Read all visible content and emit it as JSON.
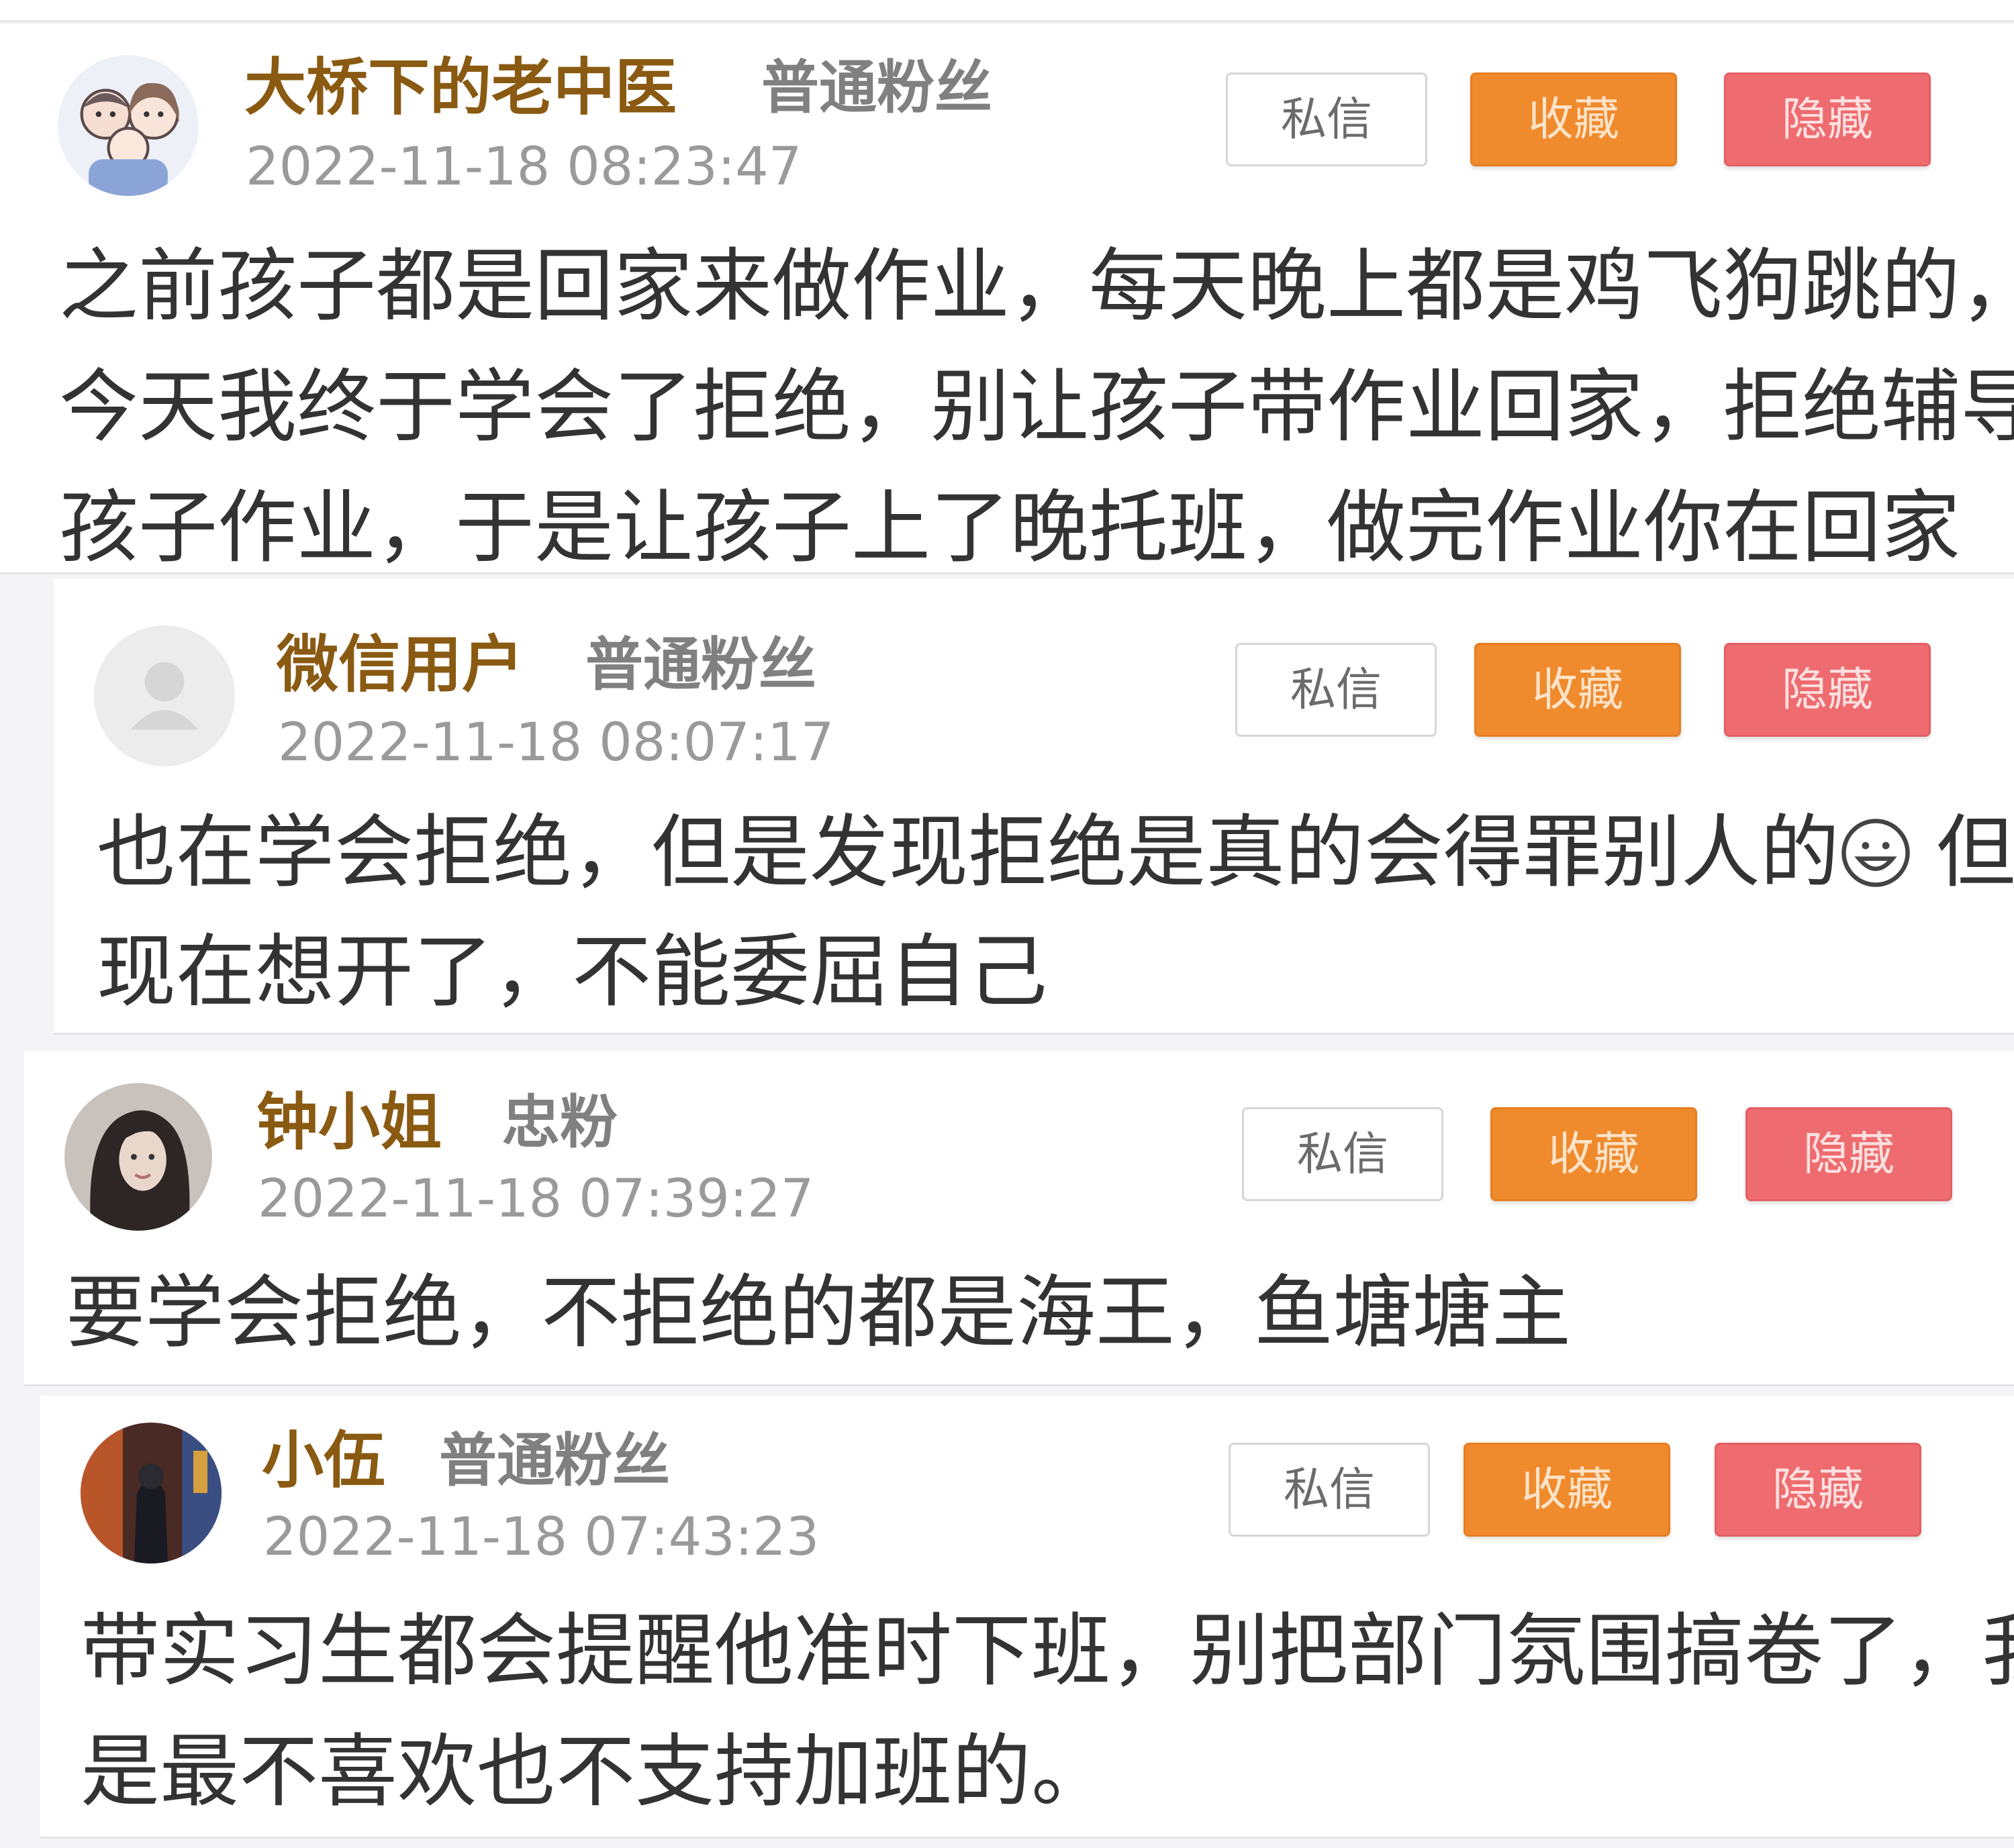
{
  "comments": [
    {
      "username": "大桥下的老中医",
      "badge": "普通粉丝",
      "time": "2022-11-18 08:23:47",
      "buttons": {
        "message": "私信",
        "favorite": "收藏",
        "hide": "隐藏"
      },
      "lines": [
        "之前孩子都是回家来做作业，每天晚上都是鸡飞狗跳的，",
        "今天我终于学会了拒绝，别让孩子带作业回家，拒绝辅导",
        "孩子作业，于是让孩子上了晚托班，做完作业你在回家"
      ]
    },
    {
      "username": "微信用户",
      "badge": "普通粉丝",
      "time": "2022-11-18 08:07:17",
      "buttons": {
        "message": "私信",
        "favorite": "收藏",
        "hide": "隐藏"
      },
      "lines": [
        "也在学会拒绝，但是发现拒绝是真的会得罪别人的",
        "但是",
        "现在想开了，不能委屈自己"
      ],
      "emoji": "grinning-face-icon"
    },
    {
      "username": "钟小姐",
      "badge": "忠粉",
      "time": "2022-11-18 07:39:27",
      "buttons": {
        "message": "私信",
        "favorite": "收藏",
        "hide": "隐藏"
      },
      "lines": [
        "要学会拒绝，不拒绝的都是海王，鱼塘塘主"
      ]
    },
    {
      "username": "小伍",
      "badge": "普通粉丝",
      "time": "2022-11-18 07:43:23",
      "buttons": {
        "message": "私信",
        "favorite": "收藏",
        "hide": "隐藏"
      },
      "lines": [
        "带实习生都会提醒他准时下班，别把部门氛围搞卷了，我",
        "是最不喜欢也不支持加班的。"
      ]
    }
  ],
  "colors": {
    "username": "#8a5a12",
    "favorite_button": "#ef8a2d",
    "hide_button": "#ee6b6f"
  }
}
